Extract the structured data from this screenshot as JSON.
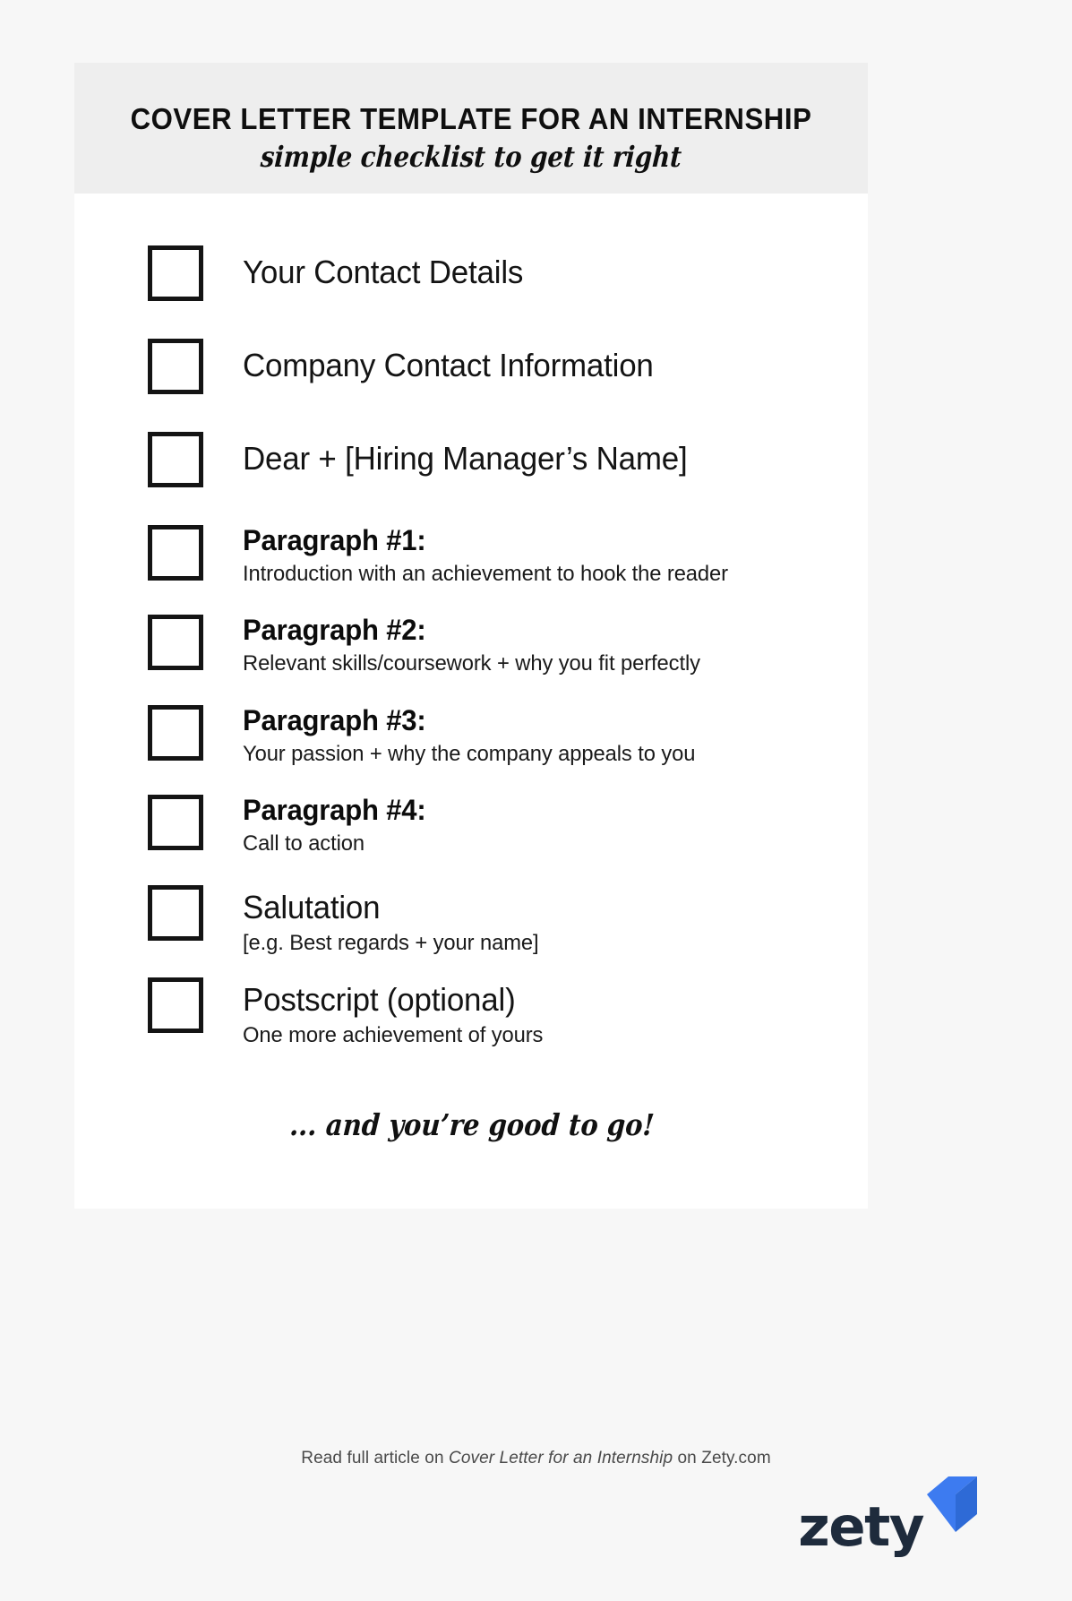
{
  "header": {
    "title": "COVER LETTER TEMPLATE FOR AN INTERNSHIP",
    "subtitle": "simple checklist to get it right"
  },
  "checklist": {
    "items": [
      {
        "label": "Your Contact Details",
        "bold": false,
        "sub": ""
      },
      {
        "label": "Company Contact Information",
        "bold": false,
        "sub": ""
      },
      {
        "label": "Dear + [Hiring Manager’s Name]",
        "bold": false,
        "sub": ""
      },
      {
        "label": "Paragraph #1:",
        "bold": true,
        "sub": "Introduction with an achievement to hook the reader"
      },
      {
        "label": "Paragraph #2:",
        "bold": true,
        "sub": "Relevant skills/coursework + why you fit perfectly"
      },
      {
        "label": "Paragraph #3:",
        "bold": true,
        "sub": "Your passion + why the company appeals to you"
      },
      {
        "label": "Paragraph #4:",
        "bold": true,
        "sub": "Call to action"
      },
      {
        "label": "Salutation",
        "bold": false,
        "sub": "[e.g. Best regards + your name]"
      },
      {
        "label": "Postscript (optional)",
        "bold": false,
        "sub": "One more achievement of yours"
      }
    ]
  },
  "closing": {
    "text": "... and you’re good to go!"
  },
  "footer": {
    "credit_prefix": "Read full article on ",
    "credit_emphasis": "Cover Letter for an Internship",
    "credit_suffix": " on Zety.com",
    "logo_wordmark": "zety",
    "logo_mark_name": "zety-arrow-logo"
  },
  "colors": {
    "page_background": "#f7f7f7",
    "card_background": "#ffffff",
    "header_band": "#eeeeee",
    "ink": "#141414",
    "muted_text": "#4a4a4a",
    "logo_navy": "#1e2b3c",
    "logo_blue_light": "#3d7bf0",
    "logo_blue_dark": "#2e6ad6"
  }
}
